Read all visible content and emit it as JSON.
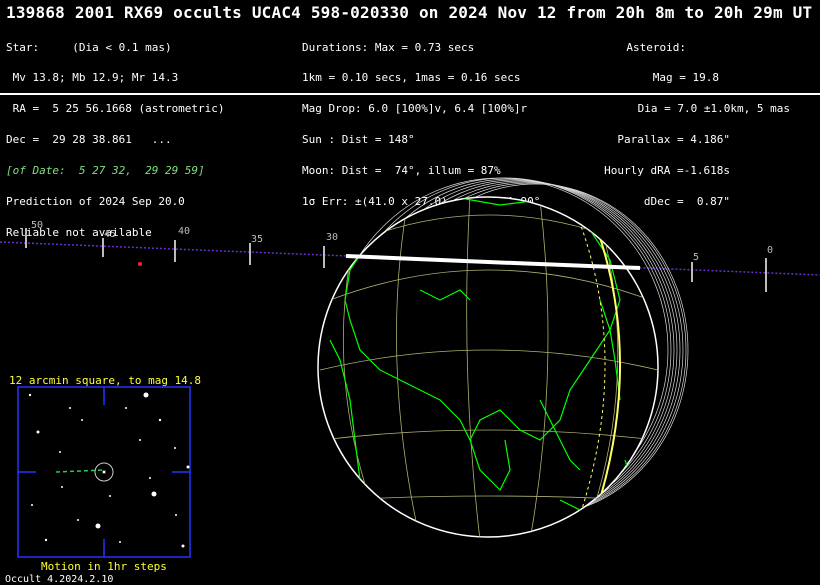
{
  "title": "139868 2001 RX69 occults UCAC4 598-020330 on 2024 Nov 12 from 20h  8m to 20h 29m UT",
  "star": {
    "lines": [
      "Star:     (Dia < 0.1 mas)",
      " Mv 13.8; Mb 12.9; Mr 14.3",
      " RA =  5 25 56.1668 (astrometric)",
      "Dec =  29 28 38.861   ...",
      "[of Date:  5 27 32,  29 29 59]",
      "Prediction of 2024 Sep 20.0",
      "Reliable not available"
    ]
  },
  "durations": {
    "lines": [
      "Durations: Max = 0.73 secs",
      "1km = 0.10 secs, 1mas = 0.16 secs",
      "Mag Drop: 6.0 [100%]v, 6.4 [100%]r",
      "Sun : Dist = 148°",
      "Moon: Dist =  74°, illum = 87%",
      "1σ Err: ±(41.0 x 27.0) mas in PA 90°"
    ]
  },
  "asteroid": {
    "lines": [
      "Asteroid:",
      "Mag = 19.8",
      "Dia = 7.0 ±1.0km, 5 mas",
      "Parallax = 4.186\"",
      "Hourly dRA =-1.618s",
      "dDec =  0.87\""
    ]
  },
  "path_ticks": [
    "50",
    "45",
    "40",
    "35",
    "30",
    "5",
    "0"
  ],
  "finder": {
    "title": "12 arcmin square, to mag 14.8",
    "caption": "Motion in 1hr steps"
  },
  "footer": "Occult 4.2024.2.10",
  "colors": {
    "background": "#000000",
    "coastline": "#00ff00",
    "grid": "#b0b070",
    "path": "#6633cc",
    "shadow_limb": "#ffff66",
    "finder_frame": "#2233ff",
    "caption": "#ffff33"
  }
}
